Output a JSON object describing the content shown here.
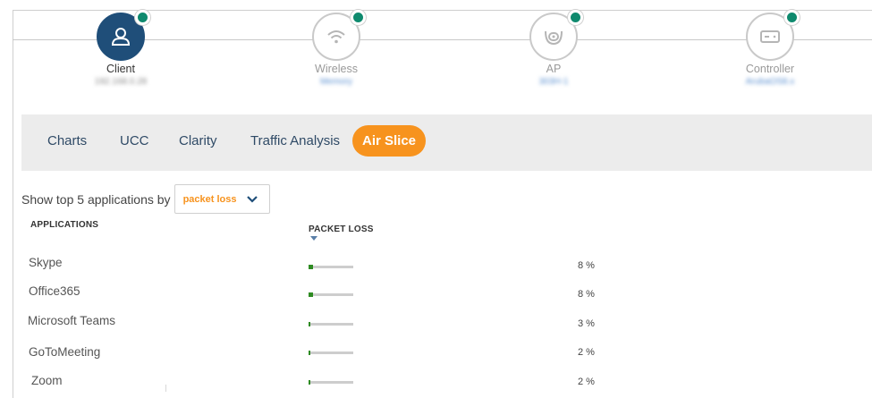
{
  "path": {
    "nodes": [
      {
        "label": "Client",
        "sub": "192.168.0.28",
        "icon": "user-icon",
        "active": true
      },
      {
        "label": "Wireless",
        "sub": "Memory",
        "icon": "wifi-icon",
        "active": false
      },
      {
        "label": "AP",
        "sub": "303H-1",
        "icon": "access-point-icon",
        "active": false
      },
      {
        "label": "Controller",
        "sub": "ArubaOS8.x",
        "icon": "controller-icon",
        "active": false
      }
    ],
    "status_color": "#0f8a6e"
  },
  "tabs": [
    {
      "label": "Charts",
      "active": false
    },
    {
      "label": "UCC",
      "active": false
    },
    {
      "label": "Clarity",
      "active": false
    },
    {
      "label": "Traffic Analysis",
      "active": false
    },
    {
      "label": "Air Slice",
      "active": true
    }
  ],
  "filter": {
    "label": "Show top 5 applications by",
    "selected": "packet loss"
  },
  "table": {
    "col_applications": "APPLICATIONS",
    "col_metric": "PACKET LOSS",
    "rows": [
      {
        "name": "Skype",
        "value": 8,
        "display": "8 %"
      },
      {
        "name": "Office365",
        "value": 8,
        "display": "8 %"
      },
      {
        "name": "Microsoft Teams",
        "value": 3,
        "display": "3 %"
      },
      {
        "name": "GoToMeeting",
        "value": 2,
        "display": "2 %"
      },
      {
        "name": "Zoom",
        "value": 2,
        "display": "2 %"
      }
    ]
  },
  "colors": {
    "accent": "#f7931e",
    "bar": "#2e8b22",
    "active_node": "#1f4e79"
  }
}
